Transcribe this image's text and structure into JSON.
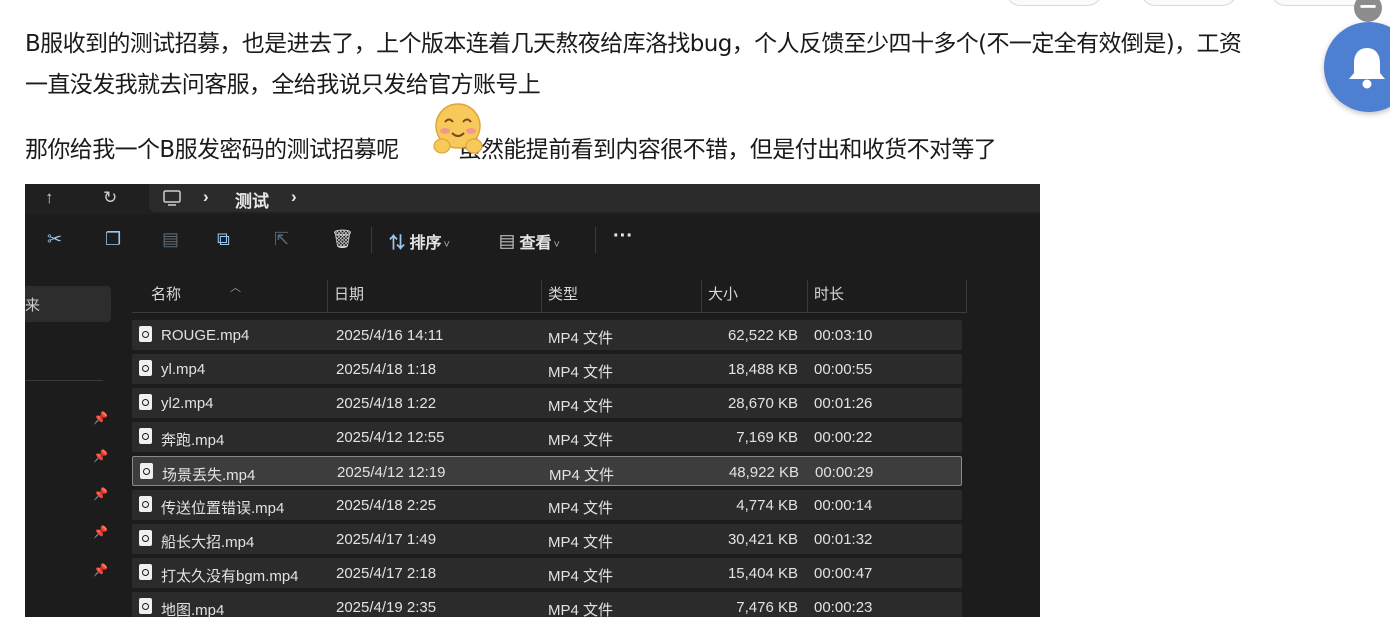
{
  "post": {
    "line1": "B服收到的测试招募，也是进去了，上个版本连着几天熬夜给库洛找bug，个人反馈至少四十多个(不一定全有效倒是)，工资",
    "line2": "一直没发我就去问客服，全给我说只发给官方账号上",
    "line3a": "那你给我一个B服发密码的测试招募呢",
    "line3b": "虽然能提前看到内容很不错，但是付出和收货不对等了",
    "emoji": "blush-emoji"
  },
  "floating": {
    "badge": "−",
    "bell": "bell-icon",
    "accent": "#4e7fd0"
  },
  "explorer": {
    "breadcrumb": {
      "separator": "›",
      "folder": "测试",
      "trailing": "›"
    },
    "toolbar": {
      "sort_label": "排序",
      "view_label": "查看",
      "more_label": "···"
    },
    "nav": {
      "partial_label": "来"
    },
    "columns": [
      "名称",
      "日期",
      "类型",
      "大小",
      "时长"
    ],
    "files": [
      {
        "name": "ROUGE.mp4",
        "date": "2025/4/16 14:11",
        "type": "MP4 文件",
        "size": "62,522 KB",
        "duration": "00:03:10"
      },
      {
        "name": "yl.mp4",
        "date": "2025/4/18 1:18",
        "type": "MP4 文件",
        "size": "18,488 KB",
        "duration": "00:00:55"
      },
      {
        "name": "yl2.mp4",
        "date": "2025/4/18 1:22",
        "type": "MP4 文件",
        "size": "28,670 KB",
        "duration": "00:01:26"
      },
      {
        "name": "奔跑.mp4",
        "date": "2025/4/12 12:55",
        "type": "MP4 文件",
        "size": "7,169 KB",
        "duration": "00:00:22"
      },
      {
        "name": "场景丢失.mp4",
        "date": "2025/4/12 12:19",
        "type": "MP4 文件",
        "size": "48,922 KB",
        "duration": "00:00:29",
        "selected": true
      },
      {
        "name": "传送位置错误.mp4",
        "date": "2025/4/18 2:25",
        "type": "MP4 文件",
        "size": "4,774 KB",
        "duration": "00:00:14"
      },
      {
        "name": "船长大招.mp4",
        "date": "2025/4/17 1:49",
        "type": "MP4 文件",
        "size": "30,421 KB",
        "duration": "00:01:32"
      },
      {
        "name": "打太久没有bgm.mp4",
        "date": "2025/4/17 2:18",
        "type": "MP4 文件",
        "size": "15,404 KB",
        "duration": "00:00:47"
      },
      {
        "name": "地图.mp4",
        "date": "2025/4/19 2:35",
        "type": "MP4 文件",
        "size": "7,476 KB",
        "duration": "00:00:23"
      }
    ]
  }
}
